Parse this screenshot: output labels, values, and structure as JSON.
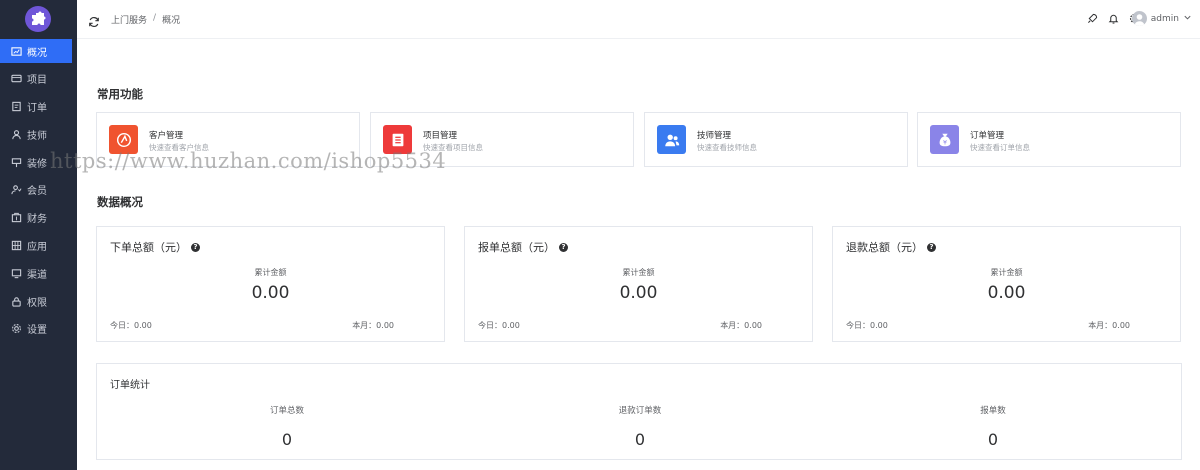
{
  "sidebar": {
    "items": [
      {
        "label": "概况",
        "icon": "dashboard-icon",
        "active": true
      },
      {
        "label": "项目",
        "icon": "card-icon"
      },
      {
        "label": "订单",
        "icon": "order-icon"
      },
      {
        "label": "技师",
        "icon": "person-icon"
      },
      {
        "label": "装修",
        "icon": "decorate-icon"
      },
      {
        "label": "会员",
        "icon": "member-icon"
      },
      {
        "label": "财务",
        "icon": "finance-icon"
      },
      {
        "label": "应用",
        "icon": "apps-icon"
      },
      {
        "label": "渠道",
        "icon": "channel-icon"
      },
      {
        "label": "权限",
        "icon": "lock-icon"
      },
      {
        "label": "设置",
        "icon": "gear-icon"
      }
    ]
  },
  "header": {
    "breadcrumb": [
      "上门服务",
      "概况"
    ],
    "separator": "/",
    "username": "admin"
  },
  "sections": {
    "common": "常用功能",
    "data": "数据概况"
  },
  "quick": [
    {
      "title": "客户管理",
      "sub": "快速查看客户信息",
      "color": "#f0532f"
    },
    {
      "title": "项目管理",
      "sub": "快速查看项目信息",
      "color": "#ee3a3a"
    },
    {
      "title": "技师管理",
      "sub": "快速查看技师信息",
      "color": "#3a7bf0"
    },
    {
      "title": "订单管理",
      "sub": "快速查看订单信息",
      "color": "#8a84e8"
    }
  ],
  "stats": [
    {
      "title": "下单总额（元）",
      "label": "累计金额",
      "value": "0.00",
      "today": "今日：0.00",
      "month": "本月：0.00"
    },
    {
      "title": "报单总额（元）",
      "label": "累计金额",
      "value": "0.00",
      "today": "今日：0.00",
      "month": "本月：0.00"
    },
    {
      "title": "退款总额（元）",
      "label": "累计金额",
      "value": "0.00",
      "today": "今日：0.00",
      "month": "本月：0.00"
    }
  ],
  "orders": {
    "title": "订单统计",
    "cols": [
      {
        "label": "订单总数",
        "value": "0"
      },
      {
        "label": "退款订单数",
        "value": "0"
      },
      {
        "label": "报单数",
        "value": "0"
      }
    ]
  },
  "watermark": "https://www.huzhan.com/ishop5534"
}
